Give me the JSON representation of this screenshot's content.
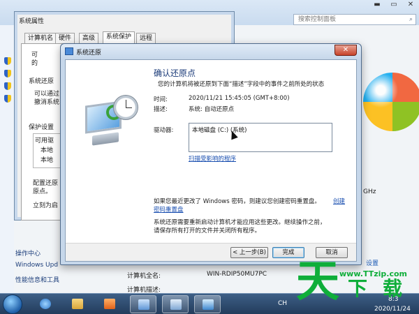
{
  "control_panel": {
    "search_placeholder": "搜索控制面板",
    "left_links": [
      "操作中心",
      "Windows Upd",
      "性能信息和工具"
    ],
    "computer_fullname_label": "计算机全名:",
    "computer_fullname_value": "WIN-RDIP50MU7PC",
    "computer_desc_label": "计算机描述:",
    "right_text_ghz": "GHz",
    "right_link_settings": "设置"
  },
  "system_properties": {
    "title": "系统属性",
    "tabs": [
      "计算机名",
      "硬件",
      "高级",
      "系统保护",
      "远程"
    ],
    "active_tab_index": 3,
    "texts": {
      "line1": "可",
      "line2": "的",
      "restore_heading": "系统还原",
      "restore_desc1": "可以通过",
      "restore_desc2": "撤消系统",
      "protection_heading": "保护设置",
      "available": "可用驱",
      "item1": "本地",
      "item2": "本地",
      "config1": "配置还原",
      "config2": "原点。",
      "create": "立刻为启"
    }
  },
  "restore_dialog": {
    "title": "系统还原",
    "heading": "确认还原点",
    "subtitle": "您的计算机将被还原到下面“描述”字段中的事件之前所处的状态",
    "time_label": "时间:",
    "time_value": "2020/11/21 15:45:05 (GMT+8:00)",
    "desc_label": "描述:",
    "desc_value": "系统: 自动还原点",
    "drive_label": "驱动器:",
    "drive_item": "本地磁盘 (C:) (系统)",
    "scan_link": "扫描受影响的程序",
    "password_note1": "如果您最近更改了 Windows 密码，则建议您创建密码重置盘。",
    "password_link1": "创建",
    "password_link2": "密码重置盘",
    "restart_note1": "系统还原需要重新启动计算机才能应用这些更改。继续操作之前，",
    "restart_note2": "请保存所有打开的文件并关闭所有程序。",
    "buttons": {
      "back": "< 上一步(B)",
      "finish": "完成",
      "cancel": "取消"
    }
  },
  "taskbar": {
    "lang": "CH",
    "time": "8:3",
    "date": "2020/11/24"
  },
  "watermark": {
    "big_char": "天",
    "site": "www.TTzip.com",
    "small1": "下",
    "small2": "载"
  },
  "colors": {
    "watermark_green": "#0fae3a",
    "link_blue": "#1a4fb0",
    "close_red": "#c7432a"
  }
}
